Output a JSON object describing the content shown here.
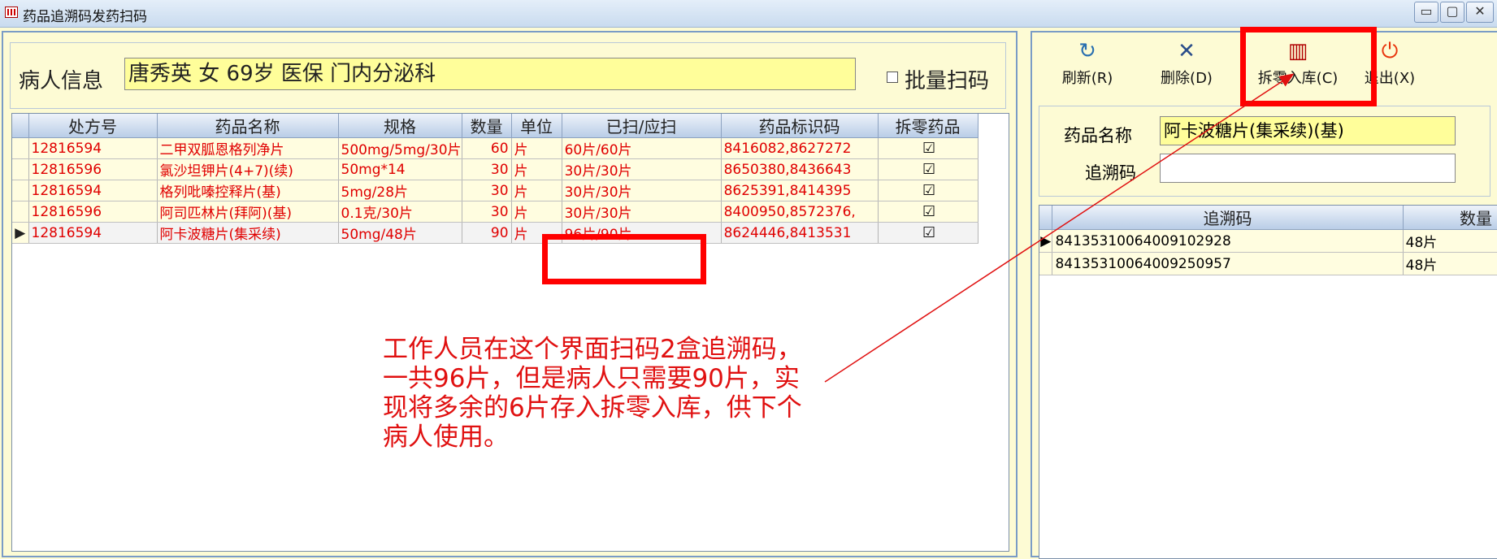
{
  "window": {
    "title": "药品追溯码发药扫码",
    "controls": {
      "minimize": "▭",
      "maximize": "▢",
      "close": "✕"
    }
  },
  "patient": {
    "label": "病人信息",
    "value": "唐秀英 女 69岁 医保 门内分泌科",
    "batch_scan_label": "批量扫码",
    "batch_scan_checked": false
  },
  "prescription_table": {
    "columns": [
      "处方号",
      "药品名称",
      "规格",
      "数量",
      "单位",
      "已扫/应扫",
      "药品标识码",
      "拆零药品"
    ],
    "rows": [
      {
        "rx_no": "12816594",
        "drug_name": "二甲双胍恩格列净片",
        "spec": "500mg/5mg/30片",
        "qty": "60",
        "unit": "片",
        "scanned": "60片/60片",
        "drug_code": "8416082,8627272",
        "split": "☑"
      },
      {
        "rx_no": "12816596",
        "drug_name": "氯沙坦钾片(4+7)(续)",
        "spec": "50mg*14",
        "qty": "30",
        "unit": "片",
        "scanned": "30片/30片",
        "drug_code": "8650380,8436643",
        "split": "☑"
      },
      {
        "rx_no": "12816594",
        "drug_name": "格列吡嗪控释片(基)",
        "spec": "5mg/28片",
        "qty": "30",
        "unit": "片",
        "scanned": "30片/30片",
        "drug_code": "8625391,8414395",
        "split": "☑"
      },
      {
        "rx_no": "12816596",
        "drug_name": "阿司匹林片(拜阿)(基)",
        "spec": "0.1克/30片",
        "qty": "30",
        "unit": "片",
        "scanned": "30片/30片",
        "drug_code": "8400950,8572376,",
        "split": "☑"
      },
      {
        "rx_no": "12816594",
        "drug_name": "阿卡波糖片(集采续)",
        "spec": "50mg/48片",
        "qty": "90",
        "unit": "片",
        "scanned": "96片/90片",
        "drug_code": "8624446,8413531",
        "split": "☑"
      }
    ],
    "selected_indicator": "▶"
  },
  "annotation": {
    "text": "工作人员在这个界面扫码2盒追溯码，一共96片，但是病人只需要90片，实现将多余的6片存入拆零入库，供下个病人使用。",
    "color": "#e01010"
  },
  "toolbar": {
    "refresh": {
      "label": "刷新(R)",
      "icon": "refresh-icon",
      "glyph": "↻"
    },
    "delete": {
      "label": "删除(D)",
      "icon": "delete-icon",
      "glyph": "✕"
    },
    "split_store": {
      "label": "拆零入库(C)",
      "icon": "barcode-icon",
      "glyph": "▥"
    },
    "exit": {
      "label": "退出(X)",
      "icon": "power-icon",
      "glyph": "⏻"
    }
  },
  "detail": {
    "drug_name_label": "药品名称",
    "drug_name_value": "阿卡波糖片(集采续)(基)",
    "trace_code_label": "追溯码",
    "trace_code_value": ""
  },
  "trace_table": {
    "columns": [
      "追溯码",
      "数量"
    ],
    "rows": [
      {
        "code": "84135310064009102928",
        "qty": "48片"
      },
      {
        "code": "84135310064009250957",
        "qty": "48片"
      }
    ],
    "selected_indicator": "▶"
  },
  "colors": {
    "highlight": "#ff0000",
    "row_text": "#e00000",
    "yellow_field": "#fffe9a",
    "panel_bg": "#fdfbd4"
  }
}
